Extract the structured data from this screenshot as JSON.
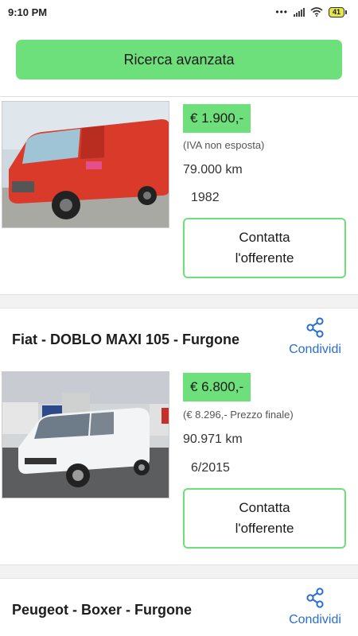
{
  "statusbar": {
    "time": "9:10 PM",
    "dots": "•••",
    "battery": "41"
  },
  "search": {
    "label": "Ricerca avanzata"
  },
  "listings": [
    {
      "title": "",
      "price": "€ 1.900,-",
      "vat_note": "(IVA non esposta)",
      "km": "79.000 km",
      "year": "1982",
      "contact_line1": "Contatta",
      "contact_line2": "l'offerente"
    },
    {
      "title": "Fiat - DOBLO MAXI 105 - Furgone",
      "share_label": "Condividi",
      "price": "€ 6.800,-",
      "vat_note": "(€ 8.296,- Prezzo finale)",
      "km": "90.971 km",
      "year": "6/2015",
      "contact_line1": "Contatta",
      "contact_line2": "l'offerente"
    },
    {
      "title": "Peugeot - Boxer - Furgone",
      "share_label": "Condividi"
    }
  ],
  "icons": {
    "share": "share-icon",
    "wifi": "wifi-icon",
    "signal": "signal-icon",
    "battery": "battery-icon"
  },
  "colors": {
    "accent_green": "#6ee07b",
    "link_blue": "#2a6fc9"
  }
}
